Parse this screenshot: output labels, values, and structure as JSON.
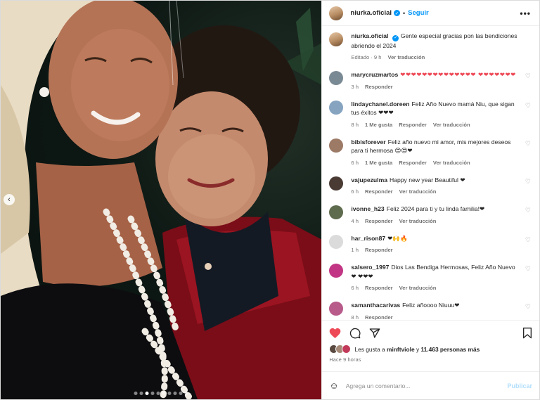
{
  "post": {
    "author": "niurka.oficial",
    "follow_label": "Seguir",
    "more_label": "•••",
    "caption": "Gente especial gracias pon las bendiciones abriendo el 2024",
    "caption_edited": "Editado · 9 h",
    "caption_translate": "Ver traducción"
  },
  "comments": [
    {
      "user": "marycruzmartos",
      "text": "❤❤❤❤❤❤❤❤❤❤❤❤❤❤ ❤❤❤❤❤❤❤",
      "time": "3 h",
      "likes": "",
      "reply": "Responder",
      "translate": "",
      "avatar_color": "#7a8a95"
    },
    {
      "user": "lindaychanel.doreen",
      "text": "Feliz Año Nuevo mamá Niu, que sigan tus éxitos ❤❤❤",
      "time": "8 h",
      "likes": "1 Me gusta",
      "reply": "Responder",
      "translate": "Ver traducción",
      "avatar_color": "#86a4c0"
    },
    {
      "user": "bibisforever",
      "text": "Feliz año nuevo mi amor, mis mejores deseos para ti hermosa 😍😍❤",
      "time": "6 h",
      "likes": "1 Me gusta",
      "reply": "Responder",
      "translate": "Ver traducción",
      "avatar_color": "#9c7a66"
    },
    {
      "user": "vajupezulma",
      "text": "Happy new year Beautiful ❤",
      "time": "6 h",
      "likes": "",
      "reply": "Responder",
      "translate": "Ver traducción",
      "avatar_color": "#4a3a34"
    },
    {
      "user": "ivonne_h23",
      "text": "Feliz 2024 para ti y tu linda familia!❤",
      "time": "4 h",
      "likes": "",
      "reply": "Responder",
      "translate": "Ver traducción",
      "avatar_color": "#5e6b4d"
    },
    {
      "user": "har_rison87",
      "text": "❤🙌🔥",
      "time": "1 h",
      "likes": "",
      "reply": "Responder",
      "translate": "",
      "avatar_color": "#dbdbdb"
    },
    {
      "user": "salsero_1997",
      "text": "Dios Las Bendiga Hermosas, Feliz Año Nuevo ❤ ❤❤❤",
      "time": "6 h",
      "likes": "",
      "reply": "Responder",
      "translate": "Ver traducción",
      "avatar_color": "#c13584"
    },
    {
      "user": "samanthacarivas",
      "text": "Feliz añoooo Niuuu❤",
      "time": "8 h",
      "likes": "",
      "reply": "Responder",
      "translate": "",
      "avatar_color": "#b85a8a"
    }
  ],
  "likes_summary": {
    "prefix": "Les gusta a",
    "user": "minftviole",
    "middle": "y",
    "count": "11.463 personas más"
  },
  "post_time": "Hace 9 horas",
  "add_comment": {
    "placeholder": "Agrega un comentario...",
    "publish_label": "Publicar"
  },
  "colors": {
    "accent": "#0095f6",
    "like_red": "#ed4956",
    "publish_disabled": "#b2dffc"
  }
}
